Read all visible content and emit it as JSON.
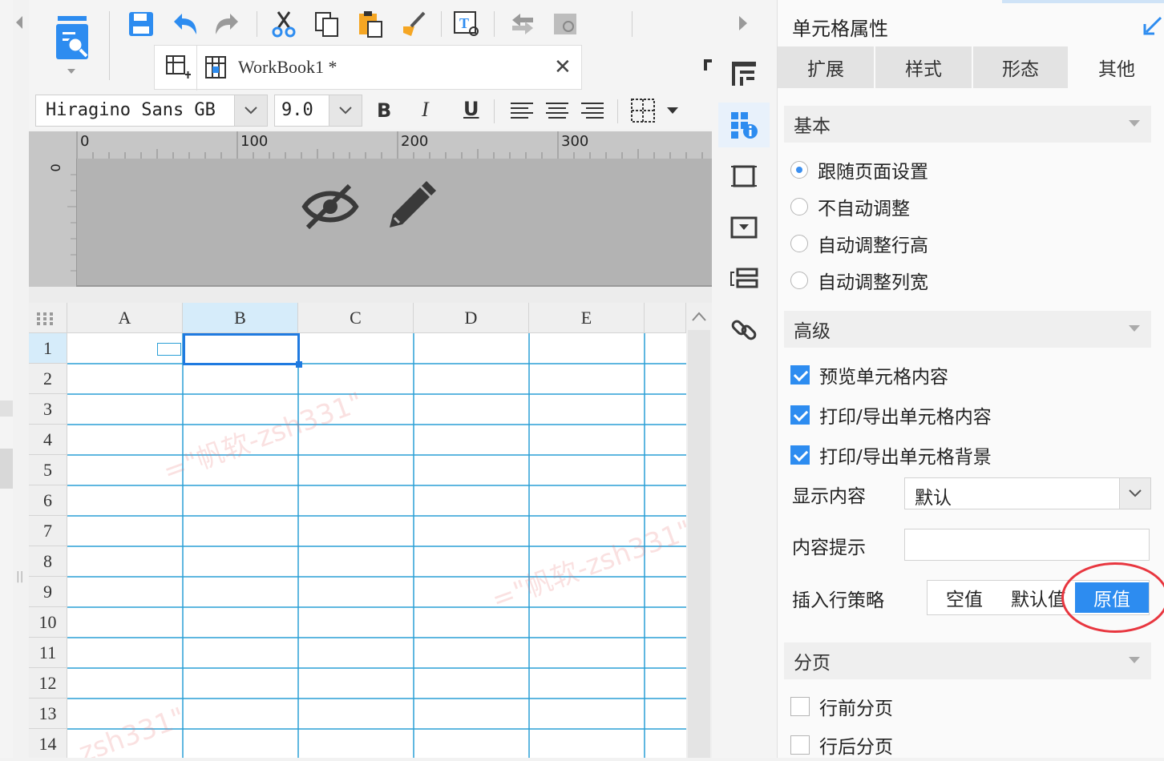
{
  "toolbar": {
    "workbook_tab": "WorkBook1 *",
    "font_name": "Hiragino Sans GB",
    "font_size": "9.0",
    "bold": "B",
    "italic": "I",
    "underline": "U"
  },
  "ruler": {
    "ticks": [
      "0",
      "100",
      "200",
      "300"
    ],
    "vertical_tick": "0"
  },
  "grid": {
    "columns": [
      "A",
      "B",
      "C",
      "D",
      "E"
    ],
    "rows": [
      "1",
      "2",
      "3",
      "4",
      "5",
      "6",
      "7",
      "8",
      "9",
      "10",
      "11",
      "12",
      "13",
      "14"
    ],
    "selected_column": "B",
    "selected_row": "1"
  },
  "watermark": {
    "text1": "=\"帆软-zsh331\"",
    "text2": "=\"帆软-zsh331\"",
    "text3": "zsh331\""
  },
  "panel": {
    "title": "单元格属性",
    "tabs": [
      "扩展",
      "样式",
      "形态",
      "其他"
    ],
    "active_tab": "其他",
    "section_basic": "基本",
    "radios": [
      {
        "label": "跟随页面设置",
        "checked": true
      },
      {
        "label": "不自动调整",
        "checked": false
      },
      {
        "label": "自动调整行高",
        "checked": false
      },
      {
        "label": "自动调整列宽",
        "checked": false
      }
    ],
    "section_advanced": "高级",
    "checks": [
      {
        "label": "预览单元格内容",
        "checked": true
      },
      {
        "label": "打印/导出单元格内容",
        "checked": true
      },
      {
        "label": "打印/导出单元格背景",
        "checked": true
      }
    ],
    "display_content_label": "显示内容",
    "display_content_value": "默认",
    "content_hint_label": "内容提示",
    "content_hint_value": "",
    "insert_policy_label": "插入行策略",
    "insert_policy_options": [
      "空值",
      "默认值",
      "原值"
    ],
    "insert_policy_selected": "原值",
    "section_paging": "分页",
    "paging_checks": [
      {
        "label": "行前分页",
        "checked": false
      },
      {
        "label": "行后分页",
        "checked": false
      }
    ]
  },
  "colors": {
    "accent": "#2d8cf0",
    "grid_line": "#2a9fd6",
    "highlight_ring": "#e8363f"
  }
}
